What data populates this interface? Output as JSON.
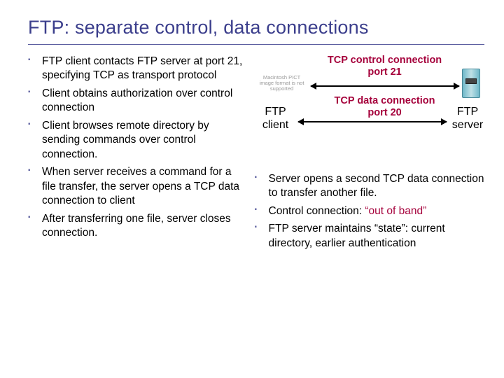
{
  "title": "FTP: separate control, data connections",
  "left_bullets": [
    "FTP client contacts FTP server at port 21, specifying TCP as transport protocol",
    "Client obtains authorization over control connection",
    "Client browses remote directory by sending commands over control connection.",
    "When server receives a command for a file transfer, the server opens a TCP data connection to client",
    "After transferring one file, server closes connection."
  ],
  "diagram": {
    "control_label_l1": "TCP control connection",
    "control_label_l2": "port 21",
    "data_label_l1": "TCP data connection",
    "data_label_l2": "port 20",
    "client_l1": "FTP",
    "client_l2": "client",
    "server_l1": "FTP",
    "server_l2": "server",
    "pict_placeholder": "Macintosh PICT image format is not supported"
  },
  "right_bullets": {
    "b1": "Server opens a second TCP data connection to transfer another file.",
    "b2_pre": "Control connection: ",
    "b2_quote": "“out of band”",
    "b3": "FTP server maintains “state”: current directory, earlier authentication"
  }
}
